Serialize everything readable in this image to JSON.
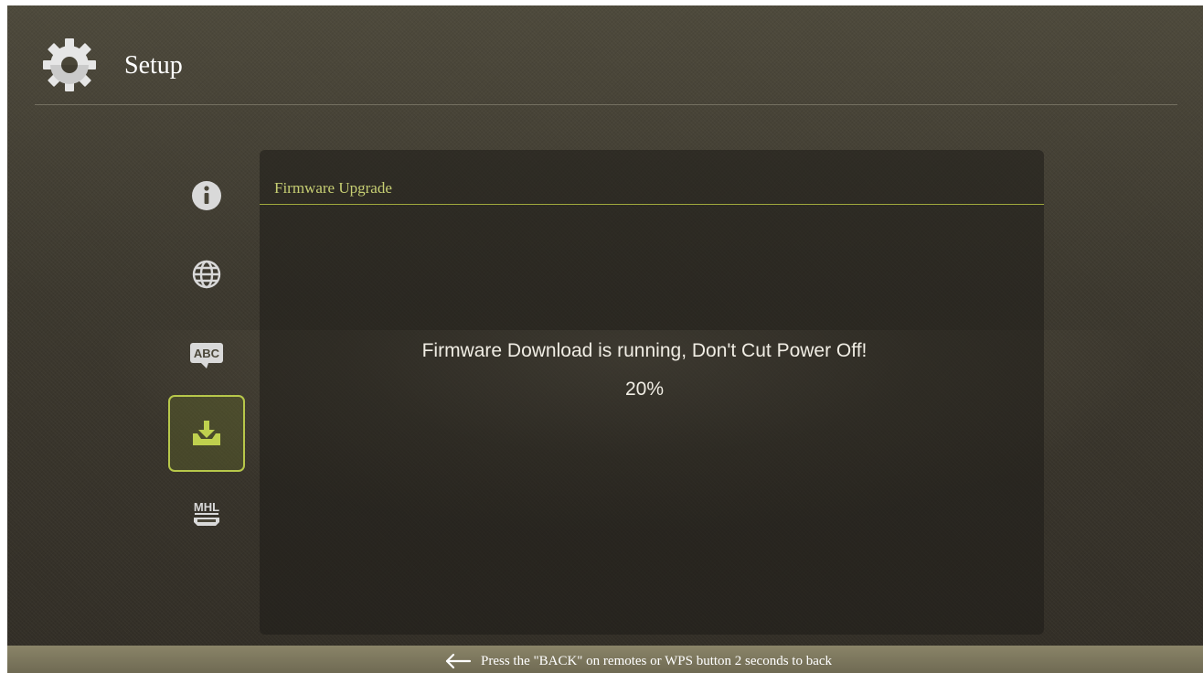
{
  "header": {
    "title": "Setup",
    "icon": "gear-icon"
  },
  "sidebar": {
    "items": [
      {
        "id": "info",
        "icon": "info-icon",
        "active": false
      },
      {
        "id": "network",
        "icon": "globe-icon",
        "active": false
      },
      {
        "id": "language",
        "icon": "abc-icon",
        "text": "ABC",
        "active": false
      },
      {
        "id": "firmware",
        "icon": "download-icon",
        "active": true
      },
      {
        "id": "mhl",
        "icon": "mhl-icon",
        "text": "MHL",
        "active": false
      }
    ]
  },
  "panel": {
    "title": "Firmware Upgrade",
    "message": "Firmware Download is running, Don't Cut Power Off!",
    "progress_text": "20%",
    "progress_fraction": 0.2
  },
  "footer": {
    "icon": "back-arrow-icon",
    "hint": "Press the \"BACK\" on remotes or WPS button 2 seconds to back"
  },
  "colors": {
    "accent": "#b7c74a",
    "panel_title": "#c7cf73",
    "background": "#3d392f",
    "footer": "#7d7860"
  }
}
